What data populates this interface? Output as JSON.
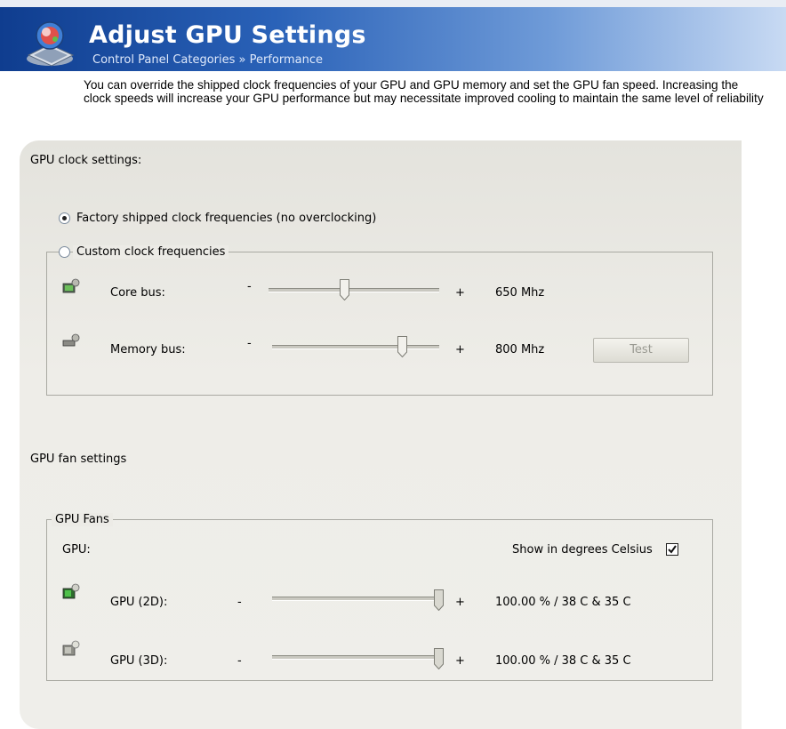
{
  "header": {
    "title": "Adjust GPU Settings",
    "breadcrumb": "Control Panel Categories  »  Performance"
  },
  "description": {
    "line1": "You can override the shipped clock frequencies of your GPU and GPU memory and set the GPU fan speed. Increasing the",
    "line2": "clock speeds will increase your GPU performance but may necessitate improved cooling to maintain the same level of reliability"
  },
  "clock": {
    "section_label": "GPU clock settings:",
    "factory_label": "Factory shipped clock frequencies (no overclocking)",
    "factory_selected": true,
    "custom_label": "Custom clock frequencies",
    "core_label": "Core bus:",
    "core_value": "650 Mhz",
    "core_level": 0.45,
    "memory_label": "Memory bus:",
    "memory_value": "800 Mhz",
    "memory_level": 0.78,
    "minus": "-",
    "plus": "+",
    "test_button": "Test"
  },
  "fans": {
    "section_label": "GPU fan settings",
    "group_label": "GPU Fans",
    "gpu_label": "GPU:",
    "celsius_label": "Show in degrees Celsius",
    "celsius_checked": true,
    "gpu2d_label": "GPU (2D):",
    "gpu2d_value": "100.00 % / 38 C & 35 C",
    "gpu2d_level": 1.0,
    "gpu3d_label": "GPU (3D):",
    "gpu3d_value": "100.00 % / 38 C & 35 C",
    "gpu3d_level": 1.0,
    "minus": "-",
    "plus": "+"
  },
  "colors": {
    "banner_start": "#0f3d8f",
    "banner_end": "#c8daf3",
    "panel": "#eeede8"
  }
}
